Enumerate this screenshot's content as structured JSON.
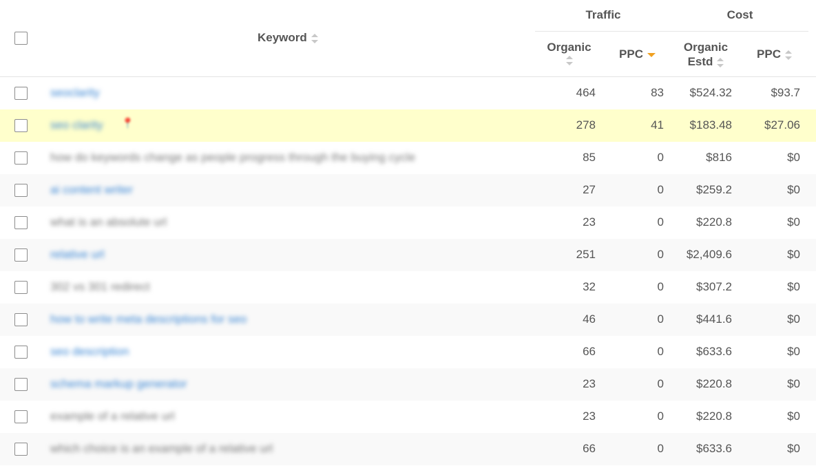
{
  "header": {
    "keyword": "Keyword",
    "traffic": "Traffic",
    "cost": "Cost",
    "organic": "Organic",
    "ppc": "PPC",
    "organic_estd_1": "Organic",
    "organic_estd_2": "Estd",
    "cost_ppc": "PPC"
  },
  "colors": {
    "link": "#3a86d4",
    "highlight_row": "#ffffcc",
    "sort_active": "#f0a020"
  },
  "rows": [
    {
      "keyword": "seoclarity",
      "link": true,
      "organic": "464",
      "ppc": "83",
      "organic_estd": "$524.32",
      "cost_ppc": "$93.7"
    },
    {
      "keyword": "seo clarity",
      "link": true,
      "highlighted": true,
      "organic": "278",
      "ppc": "41",
      "organic_estd": "$183.48",
      "cost_ppc": "$27.06"
    },
    {
      "keyword": "how do keywords change as people progress through the buying cycle",
      "link": false,
      "organic": "85",
      "ppc": "0",
      "organic_estd": "$816",
      "cost_ppc": "$0"
    },
    {
      "keyword": "ai content writer",
      "link": true,
      "organic": "27",
      "ppc": "0",
      "organic_estd": "$259.2",
      "cost_ppc": "$0"
    },
    {
      "keyword": "what is an absolute url",
      "link": false,
      "organic": "23",
      "ppc": "0",
      "organic_estd": "$220.8",
      "cost_ppc": "$0"
    },
    {
      "keyword": "relative url",
      "link": true,
      "organic": "251",
      "ppc": "0",
      "organic_estd": "$2,409.6",
      "cost_ppc": "$0"
    },
    {
      "keyword": "302 vs 301 redirect",
      "link": false,
      "organic": "32",
      "ppc": "0",
      "organic_estd": "$307.2",
      "cost_ppc": "$0"
    },
    {
      "keyword": "how to write meta descriptions for seo",
      "link": true,
      "organic": "46",
      "ppc": "0",
      "organic_estd": "$441.6",
      "cost_ppc": "$0"
    },
    {
      "keyword": "seo description",
      "link": true,
      "organic": "66",
      "ppc": "0",
      "organic_estd": "$633.6",
      "cost_ppc": "$0"
    },
    {
      "keyword": "schema markup generator",
      "link": true,
      "organic": "23",
      "ppc": "0",
      "organic_estd": "$220.8",
      "cost_ppc": "$0"
    },
    {
      "keyword": "example of a relative url",
      "link": false,
      "organic": "23",
      "ppc": "0",
      "organic_estd": "$220.8",
      "cost_ppc": "$0"
    },
    {
      "keyword": "which choice is an example of a relative url",
      "link": false,
      "organic": "66",
      "ppc": "0",
      "organic_estd": "$633.6",
      "cost_ppc": "$0"
    }
  ]
}
